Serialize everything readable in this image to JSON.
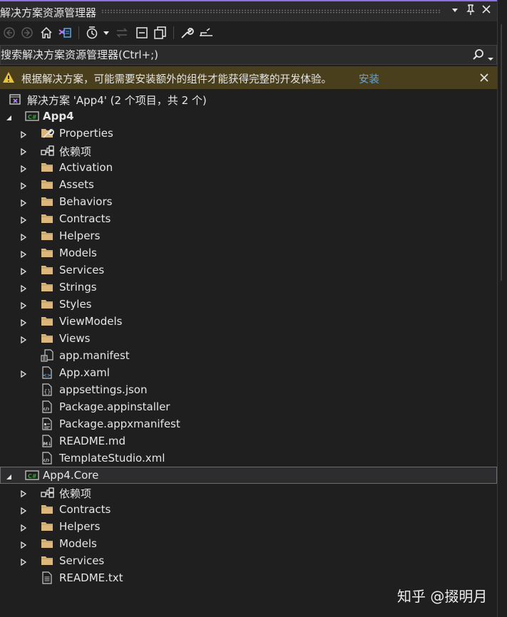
{
  "title": "解决方案资源管理器",
  "search": {
    "placeholder": "搜索解决方案资源管理器(Ctrl+;)"
  },
  "infobar": {
    "message": "根据解决方案，可能需要安装额外的组件才能获得完整的开发体验。",
    "link": "安装"
  },
  "tree": {
    "solution": "解决方案 'App4' (2 个项目，共 2 个)",
    "app4": {
      "name": "App4",
      "items": [
        "Properties",
        "依赖项",
        "Activation",
        "Assets",
        "Behaviors",
        "Contracts",
        "Helpers",
        "Models",
        "Services",
        "Strings",
        "Styles",
        "ViewModels",
        "Views",
        "app.manifest",
        "App.xaml",
        "appsettings.json",
        "Package.appinstaller",
        "Package.appxmanifest",
        "README.md",
        "TemplateStudio.xml"
      ]
    },
    "core": {
      "name": "App4.Core",
      "items": [
        "依赖项",
        "Contracts",
        "Helpers",
        "Models",
        "Services",
        "README.txt"
      ]
    }
  },
  "watermark": "知乎 @掇明月",
  "colors": {
    "accent": "#8c6fe4",
    "folder": "#dcb67a",
    "csharp": "#3c9d3c",
    "link": "#5ba7e6",
    "warning": "#e8c33a"
  }
}
